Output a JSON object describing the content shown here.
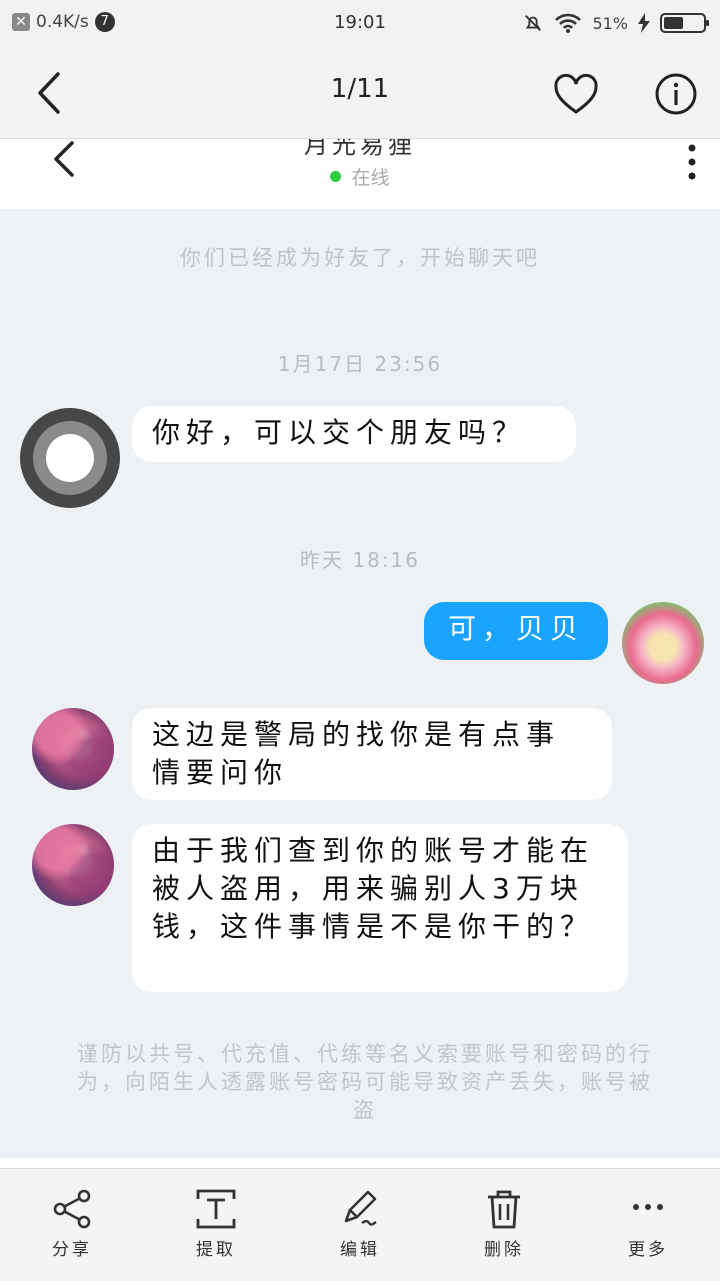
{
  "status_bar": {
    "net_speed": "0.4K/s",
    "notif_count": "7",
    "time": "19:01",
    "battery_text": "51%",
    "battery_level": 0.51
  },
  "viewer": {
    "counter": "1/11"
  },
  "chat_header": {
    "contact_name": "月光易狸",
    "status": "在线"
  },
  "chat": {
    "friend_notice": "你们已经成为好友了，开始聊天吧",
    "time_1": "1月17日 23:56",
    "msg_1": "你好，可以交个朋友吗？",
    "time_2": "昨天 18:16",
    "msg_out": "可，贝贝",
    "msg_2": "这边是警局的找你是有点事情要问你",
    "msg_3": "由于我们查到你的账号才能在被人盗用，用来骗别人3万块钱，这件事情是不是你干的？",
    "warning": "谨防以共号、代充值、代练等名义索要账号和密码的行为，向陌生人透露账号密码可能导致资产丢失，账号被盗"
  },
  "actions": [
    {
      "label": "分享",
      "icon": "share-icon"
    },
    {
      "label": "提取",
      "icon": "text-extract-icon"
    },
    {
      "label": "编辑",
      "icon": "edit-icon"
    },
    {
      "label": "删除",
      "icon": "trash-icon"
    },
    {
      "label": "更多",
      "icon": "more-icon"
    }
  ]
}
